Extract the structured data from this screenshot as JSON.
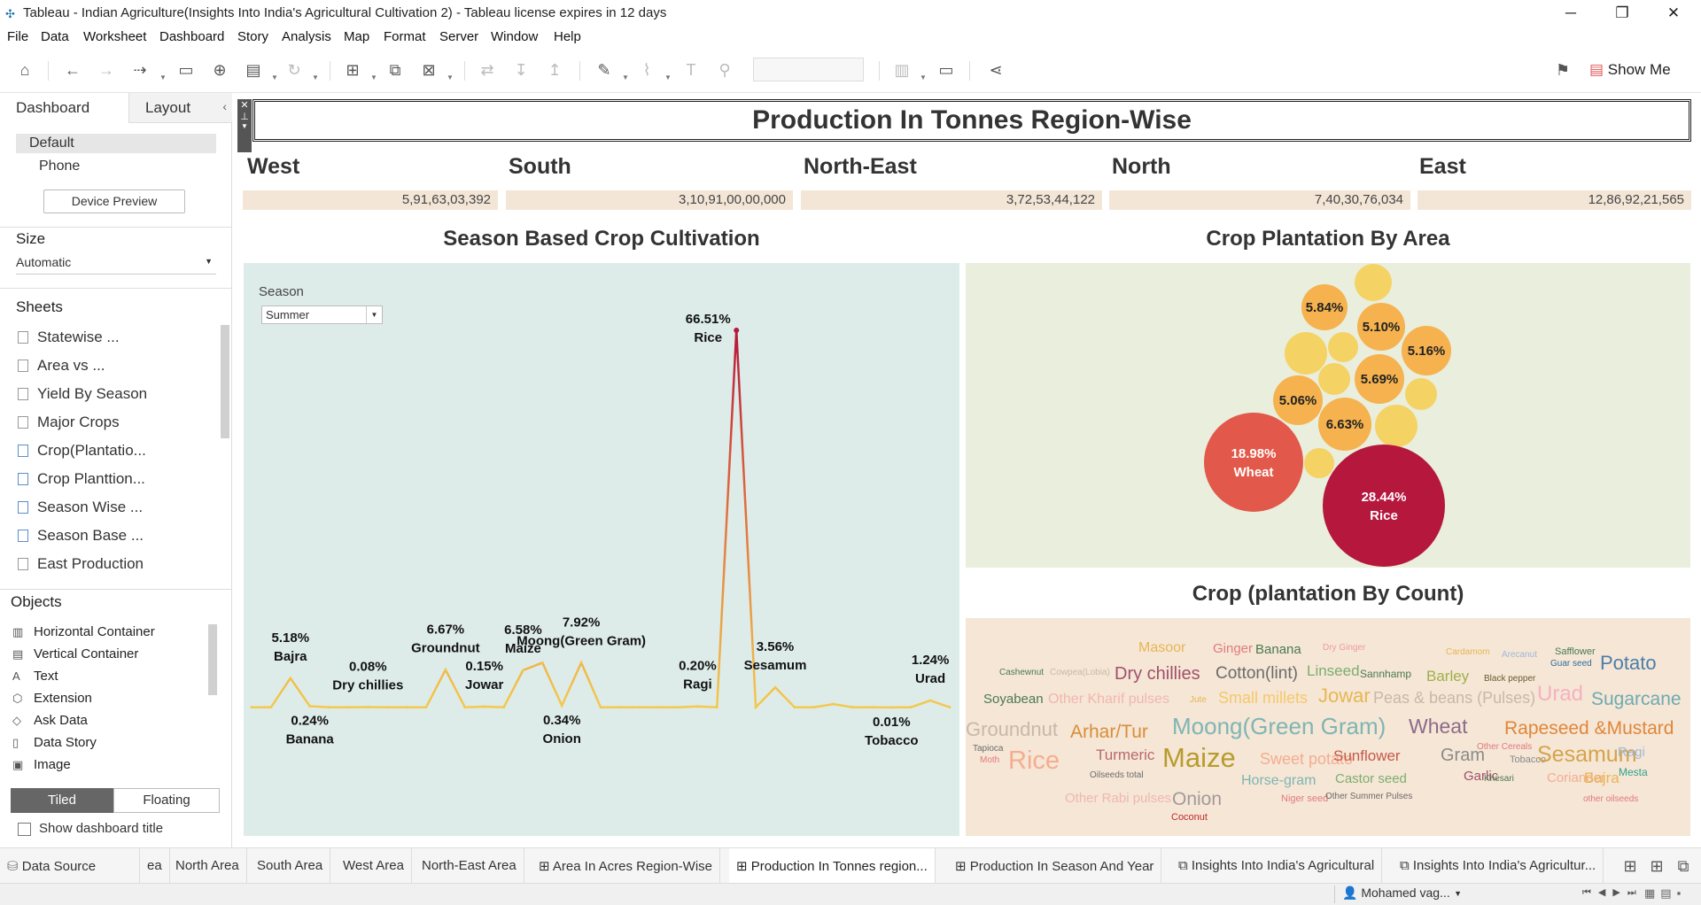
{
  "window": {
    "title": "Tableau - Indian Agriculture(Insights Into India's Agricultural Cultivation 2) - Tableau license expires in 12 days",
    "minimize": "─",
    "restore": "❐",
    "close": "✕"
  },
  "menu": [
    "File",
    "Data",
    "Worksheet",
    "Dashboard",
    "Story",
    "Analysis",
    "Map",
    "Format",
    "Server",
    "Window",
    "Help"
  ],
  "toolbar": {
    "show_me": "Show Me"
  },
  "left_panel": {
    "tabs": {
      "dashboard": "Dashboard",
      "layout": "Layout"
    },
    "device": {
      "default": "Default",
      "phone": "Phone",
      "preview_button": "Device Preview"
    },
    "size": {
      "header": "Size",
      "value": "Automatic"
    },
    "sheets": {
      "header": "Sheets",
      "items": [
        "Statewise ...",
        "Area vs ...",
        "Yield By Season",
        "Major Crops",
        "Crop(Plantatio...",
        "Crop Planttion...",
        "Season Wise ...",
        "Season Base ...",
        "East Production"
      ]
    },
    "objects": {
      "header": "Objects",
      "items": [
        "Horizontal Container",
        "Vertical Container",
        "Text",
        "Extension",
        "Ask Data",
        "Data Story",
        "Image"
      ]
    },
    "tiled": "Tiled",
    "floating": "Floating",
    "show_title": "Show dashboard title"
  },
  "dashboard": {
    "title": "Production In Tonnes Region-Wise",
    "regions": [
      {
        "name": "West",
        "value": "5,91,63,03,392"
      },
      {
        "name": "South",
        "value": "3,10,91,00,00,000"
      },
      {
        "name": "North-East",
        "value": "3,72,53,44,122"
      },
      {
        "name": "North",
        "value": "7,40,30,76,034"
      },
      {
        "name": "East",
        "value": "12,86,92,21,565"
      }
    ],
    "season_title": "Season Based Crop Cultivation",
    "area_title": "Crop Plantation By Area",
    "count_title": "Crop (plantation By Count)",
    "season_filter": {
      "label": "Season",
      "value": "Summer"
    }
  },
  "chart_data": [
    {
      "type": "line",
      "title": "Season Based Crop Cultivation",
      "x": [
        "Bajra",
        "Banana",
        "Dry chillies",
        "Groundnut",
        "Jowar",
        "Maize",
        "Onion",
        "Moong(Green Gram)",
        "Ragi",
        "Rice",
        "Sesamum",
        "Tobacco",
        "Urad"
      ],
      "values": [
        5.18,
        0.24,
        0.08,
        6.67,
        0.15,
        6.58,
        0.34,
        7.92,
        0.2,
        66.51,
        3.56,
        0.01,
        1.24
      ],
      "labels": [
        "5.18%",
        "0.24%",
        "0.08%",
        "6.67%",
        "0.15%",
        "6.58%",
        "0.34%",
        "7.92%",
        "0.20%",
        "66.51%",
        "3.56%",
        "0.01%",
        "1.24%"
      ]
    },
    {
      "type": "bubble",
      "title": "Crop Plantation By Area",
      "labeled": [
        {
          "label": "28.44%",
          "name": "Rice",
          "value": 28.44
        },
        {
          "label": "18.98%",
          "name": "Wheat",
          "value": 18.98
        },
        {
          "label": "6.63%",
          "value": 6.63
        },
        {
          "label": "5.84%",
          "value": 5.84
        },
        {
          "label": "5.69%",
          "value": 5.69
        },
        {
          "label": "5.16%",
          "value": 5.16
        },
        {
          "label": "5.10%",
          "value": 5.1
        },
        {
          "label": "5.06%",
          "value": 5.06
        }
      ]
    }
  ],
  "word_cloud": [
    "Masoor",
    "Ginger",
    "Banana",
    "Dry Ginger",
    "Cardamom",
    "Arecanut",
    "Safflower",
    "Guar seed",
    "Potato",
    "Cashewnut",
    "Cowpea(Lobia)",
    "Dry chillies",
    "Cotton(lint)",
    "Linseed",
    "Sannhamp",
    "Barley",
    "Black pepper",
    "Soyabean",
    "Other Kharif pulses",
    "Jute",
    "Small millets",
    "Jowar",
    "Peas & beans (Pulses)",
    "Urad",
    "Sugarcane",
    "Groundnut",
    "Arhar/Tur",
    "Moong(Green Gram)",
    "Wheat",
    "Rapeseed &Mustard",
    "Tapioca",
    "Moth",
    "Rice",
    "Turmeric",
    "Maize",
    "Sweet potato",
    "Sunflower",
    "Gram",
    "Other Cereals",
    "Tobacco",
    "Sesamum",
    "Ragi",
    "Oilseeds total",
    "Horse-gram",
    "Castor seed",
    "Garlic",
    "Khesari",
    "Coriander",
    "Bajra",
    "Mesta",
    "Other Rabi pulses",
    "Onion",
    "Niger seed",
    "Other Summer Pulses",
    "other oilseeds",
    "Coconut"
  ],
  "sheet_tabs": [
    "Data Source",
    "ea",
    "North Area",
    "South Area",
    "West Area",
    "North-East Area",
    "Area In Acres Region-Wise",
    "Production In Tonnes region...",
    "Production In Season And Year",
    "Insights Into India's Agricultural",
    "Insights Into India's Agricultur..."
  ],
  "status": {
    "user": "Mohamed  vag..."
  }
}
